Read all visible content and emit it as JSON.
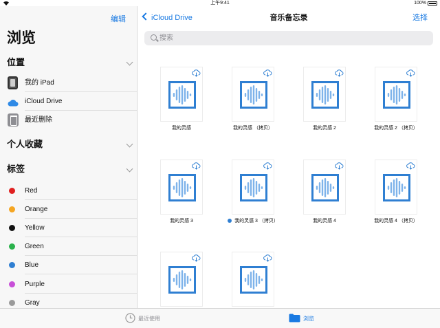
{
  "status": {
    "time": "上午9:41",
    "battery": "100%"
  },
  "sidebar": {
    "edit_label": "编辑",
    "title": "浏览",
    "sections": {
      "locations": "位置",
      "favorites": "个人收藏",
      "tags": "标签"
    },
    "locations": [
      {
        "label": "我的 iPad",
        "icon": "ipad-icon"
      },
      {
        "label": "iCloud Drive",
        "icon": "icloud-icon"
      },
      {
        "label": "最近删除",
        "icon": "trash-icon"
      }
    ],
    "tags": [
      {
        "label": "Red",
        "color": "#e02020"
      },
      {
        "label": "Orange",
        "color": "#f5a623"
      },
      {
        "label": "Yellow",
        "color": "#111111"
      },
      {
        "label": "Green",
        "color": "#2bb24c"
      },
      {
        "label": "Blue",
        "color": "#2f7fd2"
      },
      {
        "label": "Purple",
        "color": "#c850d8"
      },
      {
        "label": "Gray",
        "color": "#9a9a9a"
      }
    ]
  },
  "main": {
    "back_label": "iCloud Drive",
    "title": "音乐备忘录",
    "select_label": "选择",
    "search_placeholder": "搜索",
    "files": [
      {
        "name": "我的灵感",
        "tagged": false
      },
      {
        "name": "我的灵感 （拷贝）",
        "tagged": false
      },
      {
        "name": "我的灵感 2",
        "tagged": false
      },
      {
        "name": "我的灵感 2 （拷贝）",
        "tagged": false
      },
      {
        "name": "我的灵感 3",
        "tagged": false
      },
      {
        "name": "我的灵感 3 （拷贝）",
        "tagged": true
      },
      {
        "name": "我的灵感 4",
        "tagged": false
      },
      {
        "name": "我的灵感 4 （拷贝）",
        "tagged": false
      },
      {
        "name": "",
        "tagged": false
      },
      {
        "name": "",
        "tagged": false
      }
    ]
  },
  "tabbar": {
    "recents_label": "最近使用",
    "browse_label": "浏览",
    "accent": "#1a7ae2"
  }
}
